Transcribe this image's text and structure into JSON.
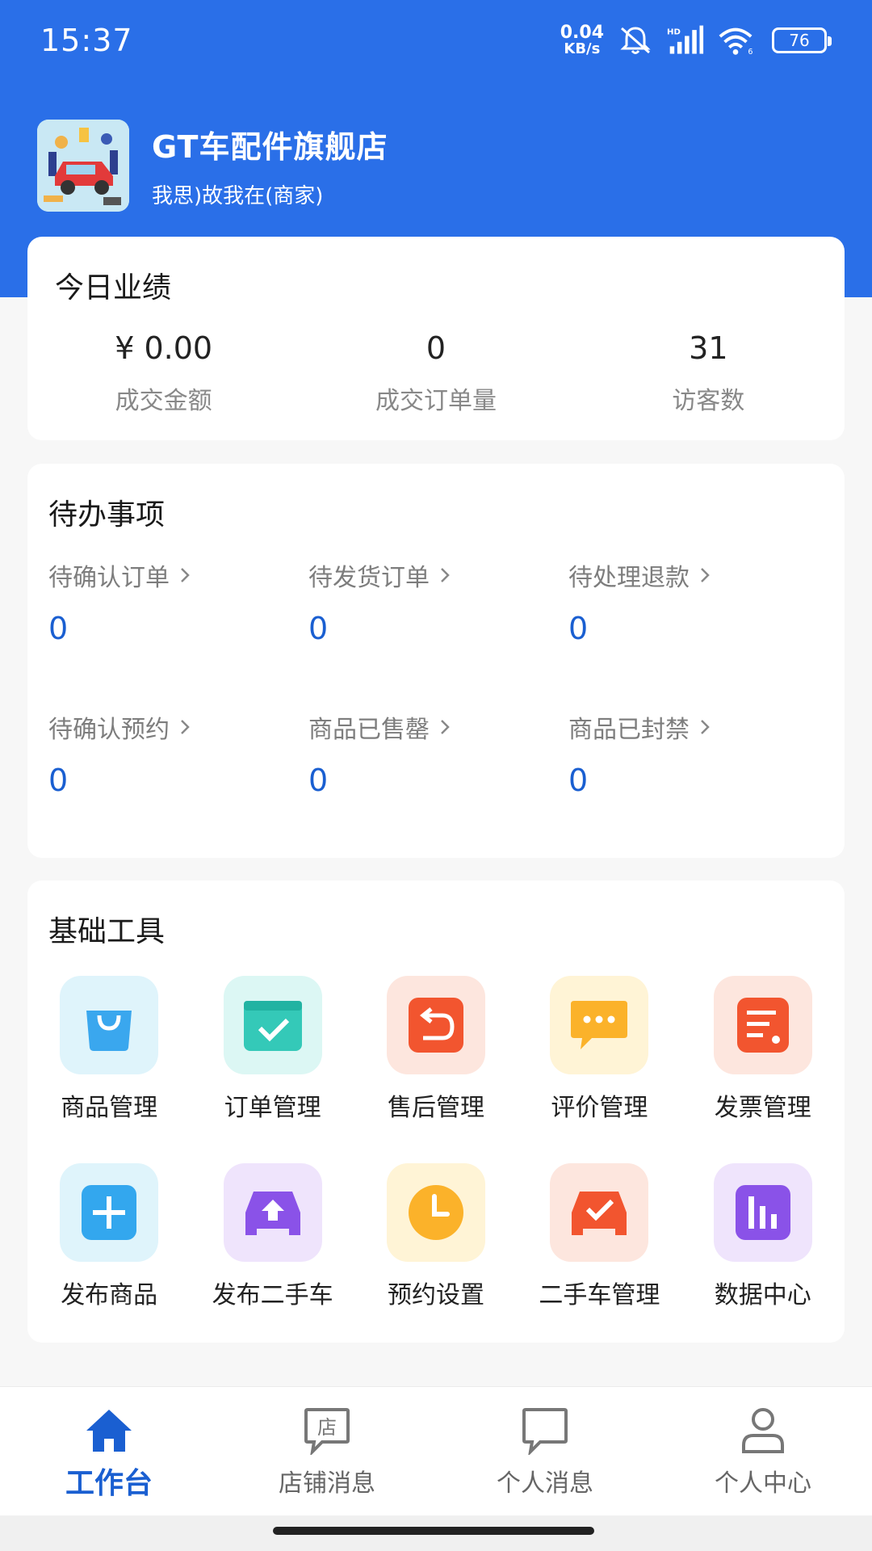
{
  "status_bar": {
    "time": "15:37",
    "net_speed_value": "0.04",
    "net_speed_unit": "KB/s",
    "battery": "76",
    "icons": [
      "mute-icon",
      "hd-signal-icon",
      "wifi-icon",
      "battery-icon"
    ]
  },
  "store": {
    "name": "GT车配件旗舰店",
    "subtitle": "我思)故我在(商家)"
  },
  "performance": {
    "title": "今日业绩",
    "stats": [
      {
        "value": "¥ 0.00",
        "label": "成交金额"
      },
      {
        "value": "0",
        "label": "成交订单量"
      },
      {
        "value": "31",
        "label": "访客数"
      }
    ]
  },
  "todo": {
    "title": "待办事项",
    "items": [
      {
        "label": "待确认订单",
        "value": "0"
      },
      {
        "label": "待发货订单",
        "value": "0"
      },
      {
        "label": "待处理退款",
        "value": "0"
      },
      {
        "label": "待确认预约",
        "value": "0"
      },
      {
        "label": "商品已售罄",
        "value": "0"
      },
      {
        "label": "商品已封禁",
        "value": "0"
      }
    ]
  },
  "tools": {
    "title": "基础工具",
    "items": [
      {
        "label": "商品管理",
        "icon": "shopping-bag-icon"
      },
      {
        "label": "订单管理",
        "icon": "order-check-icon"
      },
      {
        "label": "售后管理",
        "icon": "return-icon"
      },
      {
        "label": "评价管理",
        "icon": "comment-icon"
      },
      {
        "label": "发票管理",
        "icon": "invoice-icon"
      },
      {
        "label": "发布商品",
        "icon": "add-product-icon"
      },
      {
        "label": "发布二手车",
        "icon": "upload-car-icon"
      },
      {
        "label": "预约设置",
        "icon": "clock-icon"
      },
      {
        "label": "二手车管理",
        "icon": "car-check-icon"
      },
      {
        "label": "数据中心",
        "icon": "bar-chart-icon"
      }
    ]
  },
  "bottom_nav": {
    "items": [
      {
        "label": "工作台",
        "icon": "home-icon",
        "active": true
      },
      {
        "label": "店铺消息",
        "icon": "store-message-icon",
        "store_char": "店"
      },
      {
        "label": "个人消息",
        "icon": "chat-icon"
      },
      {
        "label": "个人中心",
        "icon": "user-icon"
      }
    ]
  },
  "colors": {
    "header_blue": "#2a6fe8",
    "accent_blue": "#1a5fd1"
  }
}
